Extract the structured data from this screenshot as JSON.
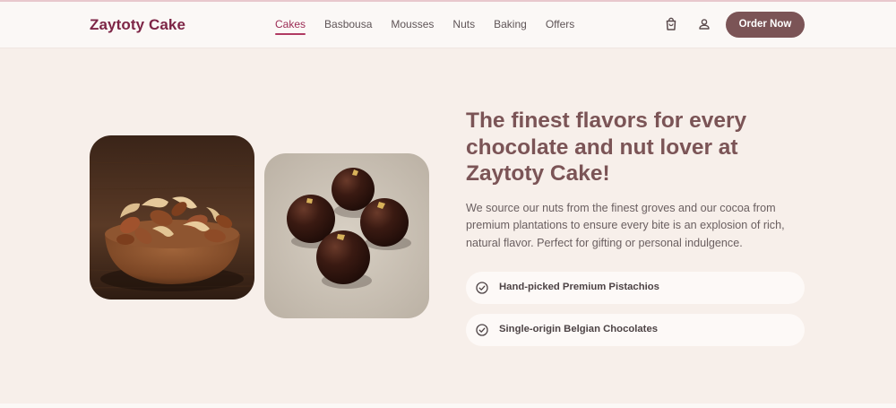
{
  "header": {
    "logo": "Zaytoty Cake",
    "nav": [
      {
        "label": "Cakes",
        "active": true
      },
      {
        "label": "Basbousa",
        "active": false
      },
      {
        "label": "Mousses",
        "active": false
      },
      {
        "label": "Nuts",
        "active": false
      },
      {
        "label": "Baking",
        "active": false
      },
      {
        "label": "Offers",
        "active": false
      }
    ],
    "icons": [
      "shopping-bag-icon",
      "user-icon"
    ],
    "cta_label": "Order Now"
  },
  "hero": {
    "headline": "The finest flavors for every chocolate and nut lover at Zaytoty Cake!",
    "description": "We source our nuts from the finest groves and our cocoa from premium plantations to ensure every bite is an explosion of rich, natural flavor. Perfect for gifting or personal indulgence.",
    "features": [
      "Hand-picked Premium Pistachios",
      "Single-origin Belgian Chocolates"
    ],
    "images": [
      "mixed-nuts-bowl-photo",
      "chocolate-truffles-photo"
    ]
  },
  "colors": {
    "accent": "#7b5456",
    "brand": "#7d2546",
    "active_nav": "#9c2c55",
    "background": "#f7efea"
  }
}
